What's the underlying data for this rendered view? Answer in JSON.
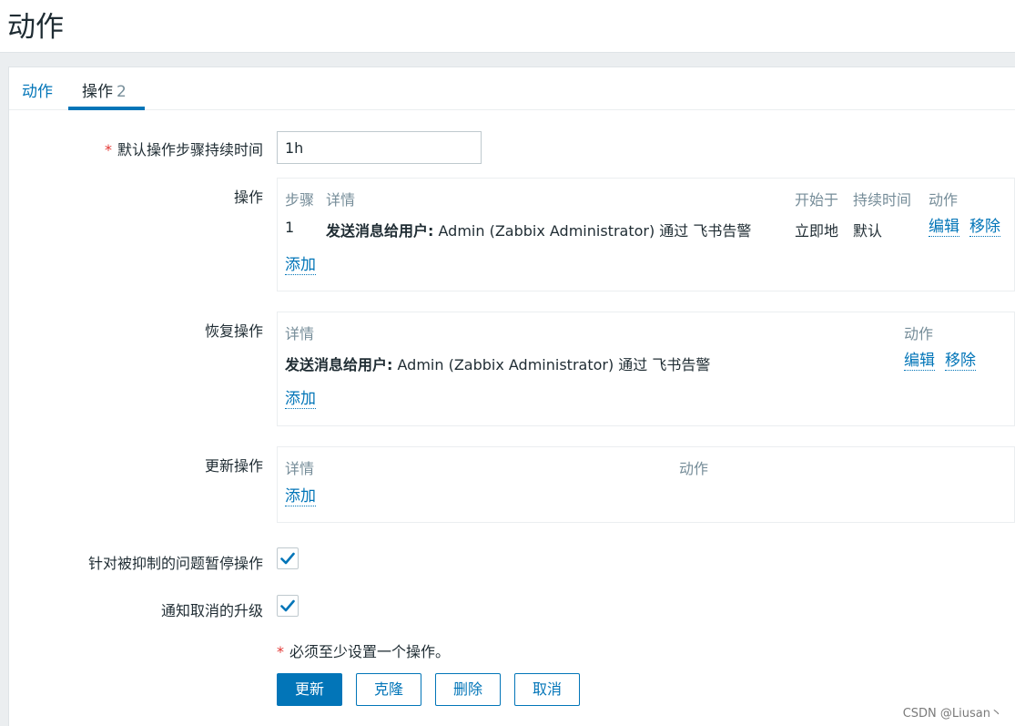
{
  "page": {
    "title": "动作"
  },
  "tabs": [
    {
      "label": "动作"
    },
    {
      "label": "操作",
      "count": "2"
    }
  ],
  "form": {
    "default_duration": {
      "label": "默认操作步骤持续时间",
      "value": "1h"
    },
    "operations": {
      "label": "操作",
      "headers": {
        "step": "步骤",
        "details": "详情",
        "start": "开始于",
        "duration": "持续时间",
        "action": "动作"
      },
      "rows": [
        {
          "step": "1",
          "details_bold": "发送消息给用户:",
          "details_rest": " Admin (Zabbix Administrator) 通过 飞书告警",
          "start": "立即地",
          "duration": "默认",
          "edit": "编辑",
          "remove": "移除"
        }
      ],
      "add": "添加"
    },
    "recovery": {
      "label": "恢复操作",
      "headers": {
        "details": "详情",
        "action": "动作"
      },
      "rows": [
        {
          "details_bold": "发送消息给用户:",
          "details_rest": " Admin (Zabbix Administrator) 通过 飞书告警",
          "edit": "编辑",
          "remove": "移除"
        }
      ],
      "add": "添加"
    },
    "update": {
      "label": "更新操作",
      "headers": {
        "details": "详情",
        "action": "动作"
      },
      "add": "添加"
    },
    "pause_suppressed": {
      "label": "针对被抑制的问题暂停操作",
      "checked": true
    },
    "notify_cancel": {
      "label": "通知取消的升级",
      "checked": true
    },
    "required_note": "必须至少设置一个操作。",
    "buttons": {
      "update": "更新",
      "clone": "克隆",
      "delete": "删除",
      "cancel": "取消"
    }
  },
  "watermark": "CSDN @Liusan丶",
  "colors": {
    "accent": "#0275b8",
    "required": "#e33734",
    "header_text": "#768d99"
  }
}
